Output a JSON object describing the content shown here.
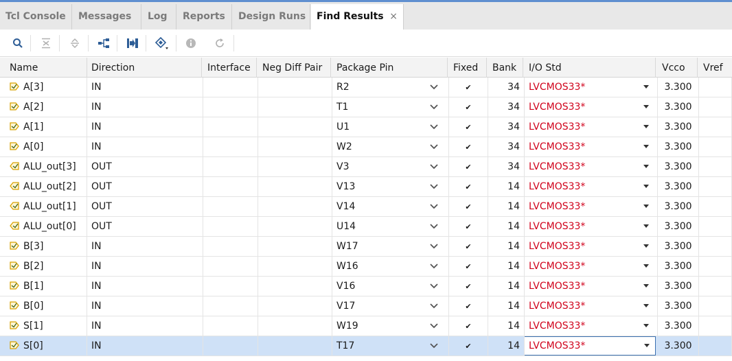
{
  "tabs": [
    {
      "label": "Tcl Console"
    },
    {
      "label": "Messages"
    },
    {
      "label": "Log"
    },
    {
      "label": "Reports"
    },
    {
      "label": "Design Runs"
    },
    {
      "label": "Find Results",
      "active": true
    }
  ],
  "tab_close_glyph": "×",
  "toolbar": {
    "icons": [
      "search-icon",
      "collapse-all-icon",
      "expand-all-icon",
      "hierarchy-icon",
      "goto-icon",
      "properties-icon",
      "info-icon",
      "refresh-icon"
    ]
  },
  "columns": [
    "Name",
    "Direction",
    "Interface",
    "Neg Diff Pair",
    "Package Pin",
    "Fixed",
    "Bank",
    "I/O Std",
    "Vcco",
    "Vref"
  ],
  "rows": [
    {
      "name": "A[3]",
      "dir": "IN",
      "interface": "",
      "negdiff": "",
      "pin": "R2",
      "fixed": "✔",
      "bank": "34",
      "iostd": "LVCMOS33*",
      "vcco": "3.300",
      "vref": ""
    },
    {
      "name": "A[2]",
      "dir": "IN",
      "interface": "",
      "negdiff": "",
      "pin": "T1",
      "fixed": "✔",
      "bank": "34",
      "iostd": "LVCMOS33*",
      "vcco": "3.300",
      "vref": ""
    },
    {
      "name": "A[1]",
      "dir": "IN",
      "interface": "",
      "negdiff": "",
      "pin": "U1",
      "fixed": "✔",
      "bank": "34",
      "iostd": "LVCMOS33*",
      "vcco": "3.300",
      "vref": ""
    },
    {
      "name": "A[0]",
      "dir": "IN",
      "interface": "",
      "negdiff": "",
      "pin": "W2",
      "fixed": "✔",
      "bank": "34",
      "iostd": "LVCMOS33*",
      "vcco": "3.300",
      "vref": ""
    },
    {
      "name": "ALU_out[3]",
      "dir": "OUT",
      "interface": "",
      "negdiff": "",
      "pin": "V3",
      "fixed": "✔",
      "bank": "34",
      "iostd": "LVCMOS33*",
      "vcco": "3.300",
      "vref": ""
    },
    {
      "name": "ALU_out[2]",
      "dir": "OUT",
      "interface": "",
      "negdiff": "",
      "pin": "V13",
      "fixed": "✔",
      "bank": "14",
      "iostd": "LVCMOS33*",
      "vcco": "3.300",
      "vref": ""
    },
    {
      "name": "ALU_out[1]",
      "dir": "OUT",
      "interface": "",
      "negdiff": "",
      "pin": "V14",
      "fixed": "✔",
      "bank": "14",
      "iostd": "LVCMOS33*",
      "vcco": "3.300",
      "vref": ""
    },
    {
      "name": "ALU_out[0]",
      "dir": "OUT",
      "interface": "",
      "negdiff": "",
      "pin": "U14",
      "fixed": "✔",
      "bank": "14",
      "iostd": "LVCMOS33*",
      "vcco": "3.300",
      "vref": ""
    },
    {
      "name": "B[3]",
      "dir": "IN",
      "interface": "",
      "negdiff": "",
      "pin": "W17",
      "fixed": "✔",
      "bank": "14",
      "iostd": "LVCMOS33*",
      "vcco": "3.300",
      "vref": ""
    },
    {
      "name": "B[2]",
      "dir": "IN",
      "interface": "",
      "negdiff": "",
      "pin": "W16",
      "fixed": "✔",
      "bank": "14",
      "iostd": "LVCMOS33*",
      "vcco": "3.300",
      "vref": ""
    },
    {
      "name": "B[1]",
      "dir": "IN",
      "interface": "",
      "negdiff": "",
      "pin": "V16",
      "fixed": "✔",
      "bank": "14",
      "iostd": "LVCMOS33*",
      "vcco": "3.300",
      "vref": ""
    },
    {
      "name": "B[0]",
      "dir": "IN",
      "interface": "",
      "negdiff": "",
      "pin": "V17",
      "fixed": "✔",
      "bank": "14",
      "iostd": "LVCMOS33*",
      "vcco": "3.300",
      "vref": ""
    },
    {
      "name": "S[1]",
      "dir": "IN",
      "interface": "",
      "negdiff": "",
      "pin": "W19",
      "fixed": "✔",
      "bank": "14",
      "iostd": "LVCMOS33*",
      "vcco": "3.300",
      "vref": ""
    },
    {
      "name": "S[0]",
      "dir": "IN",
      "interface": "",
      "negdiff": "",
      "pin": "T17",
      "fixed": "✔",
      "bank": "14",
      "iostd": "LVCMOS33*",
      "vcco": "3.300",
      "vref": "",
      "selected": true
    }
  ],
  "colors": {
    "accent": "#5f8fd0",
    "iostd_text": "#d0021b",
    "selected_row": "#cfe1f7",
    "port_icon": "#d8a200"
  }
}
